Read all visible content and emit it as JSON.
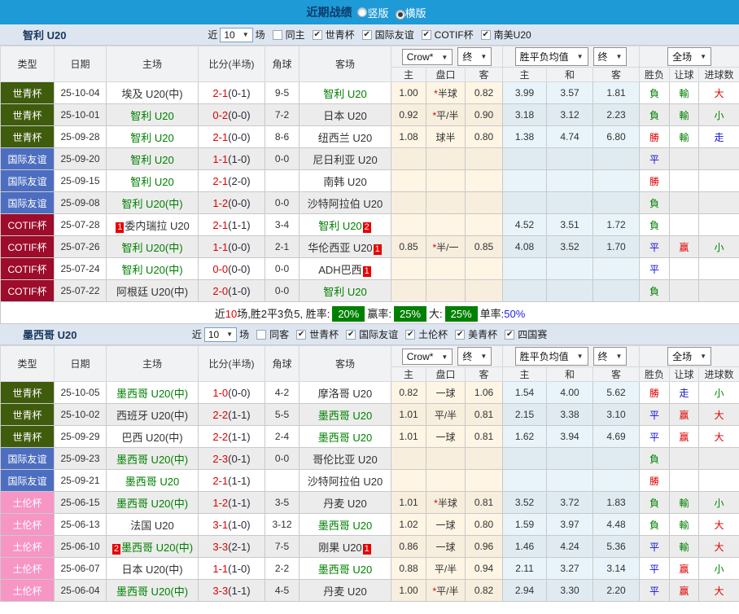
{
  "colors": {
    "topbar_blue": "#1e9ad6",
    "topbar_title": "#0b3b6a",
    "focus_team_green": "#008000",
    "score_red": "#e00000",
    "red_card_badge": "#e60000",
    "comp_world_youth": "#3f5b0c",
    "comp_friendly": "#4d6ec0",
    "comp_cotif": "#9d0c2a",
    "comp_toulon": "#f795c5",
    "summary_badge_green": "#008000"
  },
  "top_bar": {
    "title": "近期战绩",
    "radios": [
      {
        "label": "竖版",
        "selected": false
      },
      {
        "label": "横版",
        "selected": true
      }
    ]
  },
  "table_header": {
    "cols": [
      "类型",
      "日期",
      "主场",
      "比分(半场)",
      "角球",
      "客场"
    ],
    "odds_company_select": "Crow*",
    "odds_stage_select": "终",
    "avg_select": "胜平负均值",
    "avg_stage_select": "终",
    "scope_select": "全场",
    "sub_cols": [
      "主",
      "盘口",
      "客",
      "主",
      "和",
      "客",
      "胜负",
      "让球",
      "进球数"
    ]
  },
  "sections": [
    {
      "id": "chile-u20",
      "title": "智利 U20",
      "filter": {
        "near_label": "近",
        "count_value": "10",
        "games_label": "场",
        "same_venue": {
          "label": "同主",
          "checked": false
        },
        "comps": [
          {
            "label": "世青杯",
            "checked": true
          },
          {
            "label": "国际友谊",
            "checked": true
          },
          {
            "label": "COTIF杯",
            "checked": true
          },
          {
            "label": "南美U20",
            "checked": true
          }
        ]
      },
      "rows": [
        {
          "comp": "世青杯",
          "type": "wc",
          "date": "25-10-04",
          "home": {
            "n": "埃及 U20(中)",
            "f": false
          },
          "ft": "2-1",
          "ht": "(0-1)",
          "cr": "9-5",
          "away": {
            "n": "智利 U20",
            "f": true
          },
          "odds": [
            "1.00",
            "*半球",
            "0.82"
          ],
          "avg": [
            "3.99",
            "3.57",
            "1.81"
          ],
          "res": [
            [
              "負",
              "g"
            ],
            [
              "輸",
              "g"
            ],
            [
              "大",
              "r"
            ]
          ]
        },
        {
          "comp": "世青杯",
          "type": "wc",
          "date": "25-10-01",
          "home": {
            "n": "智利 U20",
            "f": true
          },
          "ft": "0-2",
          "ht": "(0-0)",
          "cr": "7-2",
          "away": {
            "n": "日本 U20",
            "f": false
          },
          "odds": [
            "0.92",
            "*平/半",
            "0.90"
          ],
          "avg": [
            "3.18",
            "3.12",
            "2.23"
          ],
          "res": [
            [
              "負",
              "g"
            ],
            [
              "輸",
              "g"
            ],
            [
              "小",
              "g"
            ]
          ]
        },
        {
          "comp": "世青杯",
          "type": "wc",
          "date": "25-09-28",
          "home": {
            "n": "智利 U20",
            "f": true
          },
          "ft": "2-1",
          "ht": "(0-0)",
          "cr": "8-6",
          "away": {
            "n": "纽西兰 U20",
            "f": false
          },
          "odds": [
            "1.08",
            "球半",
            "0.80"
          ],
          "avg": [
            "1.38",
            "4.74",
            "6.80"
          ],
          "res": [
            [
              "勝",
              "r"
            ],
            [
              "輸",
              "g"
            ],
            [
              "走",
              "b"
            ]
          ]
        },
        {
          "comp": "国际友谊",
          "type": "fr",
          "date": "25-09-20",
          "home": {
            "n": "智利 U20",
            "f": true
          },
          "ft": "1-1",
          "ht": "(1-0)",
          "cr": "0-0",
          "away": {
            "n": "尼日利亚 U20",
            "f": false
          },
          "odds": [
            "",
            "",
            ""
          ],
          "avg": [
            "",
            "",
            ""
          ],
          "res": [
            [
              "平",
              "b"
            ],
            [
              "",
              ""
            ],
            [
              "",
              ""
            ]
          ]
        },
        {
          "comp": "国际友谊",
          "type": "fr",
          "date": "25-09-15",
          "home": {
            "n": "智利 U20",
            "f": true
          },
          "ft": "2-1",
          "ht": "(2-0)",
          "cr": "",
          "away": {
            "n": "南韩 U20",
            "f": false
          },
          "odds": [
            "",
            "",
            ""
          ],
          "avg": [
            "",
            "",
            ""
          ],
          "res": [
            [
              "勝",
              "r"
            ],
            [
              "",
              ""
            ],
            [
              "",
              ""
            ]
          ]
        },
        {
          "comp": "国际友谊",
          "type": "fr",
          "date": "25-09-08",
          "home": {
            "n": "智利 U20(中)",
            "f": true
          },
          "ft": "1-2",
          "ht": "(0-0)",
          "cr": "0-0",
          "away": {
            "n": "沙特阿拉伯 U20",
            "f": false
          },
          "odds": [
            "",
            "",
            ""
          ],
          "avg": [
            "",
            "",
            ""
          ],
          "res": [
            [
              "負",
              "g"
            ],
            [
              "",
              ""
            ],
            [
              "",
              ""
            ]
          ]
        },
        {
          "comp": "COTIF杯",
          "type": "cotif",
          "date": "25-07-28",
          "home": {
            "n": "委内瑞拉 U20",
            "f": false,
            "bb": "1"
          },
          "ft": "2-1",
          "ht": "(1-1)",
          "cr": "3-4",
          "away": {
            "n": "智利 U20",
            "f": true,
            "ba": "2"
          },
          "odds": [
            "",
            "",
            ""
          ],
          "avg": [
            "4.52",
            "3.51",
            "1.72"
          ],
          "res": [
            [
              "負",
              "g"
            ],
            [
              "",
              ""
            ],
            [
              "",
              ""
            ]
          ]
        },
        {
          "comp": "COTIF杯",
          "type": "cotif",
          "date": "25-07-26",
          "home": {
            "n": "智利 U20(中)",
            "f": true
          },
          "ft": "1-1",
          "ht": "(0-0)",
          "cr": "2-1",
          "away": {
            "n": "华伦西亚 U20",
            "f": false,
            "ba": "1"
          },
          "odds": [
            "0.85",
            "*半/一",
            "0.85"
          ],
          "avg": [
            "4.08",
            "3.52",
            "1.70"
          ],
          "res": [
            [
              "平",
              "b"
            ],
            [
              "赢",
              "r"
            ],
            [
              "小",
              "g"
            ]
          ]
        },
        {
          "comp": "COTIF杯",
          "type": "cotif",
          "date": "25-07-24",
          "home": {
            "n": "智利 U20(中)",
            "f": true
          },
          "ft": "0-0",
          "ht": "(0-0)",
          "cr": "0-0",
          "away": {
            "n": "ADH巴西",
            "f": false,
            "ba": "1"
          },
          "odds": [
            "",
            "",
            ""
          ],
          "avg": [
            "",
            "",
            ""
          ],
          "res": [
            [
              "平",
              "b"
            ],
            [
              "",
              ""
            ],
            [
              "",
              ""
            ]
          ]
        },
        {
          "comp": "COTIF杯",
          "type": "cotif",
          "date": "25-07-22",
          "home": {
            "n": "阿根廷 U20(中)",
            "f": false
          },
          "ft": "2-0",
          "ht": "(1-0)",
          "cr": "0-0",
          "away": {
            "n": "智利 U20",
            "f": true
          },
          "odds": [
            "",
            "",
            ""
          ],
          "avg": [
            "",
            "",
            ""
          ],
          "res": [
            [
              "負",
              "g"
            ],
            [
              "",
              ""
            ],
            [
              "",
              ""
            ]
          ]
        }
      ],
      "summary_segments": [
        [
          "近",
          "k"
        ],
        [
          "10",
          "r"
        ],
        [
          "场,胜2平3负5, 胜率:",
          "k"
        ],
        [
          "20%",
          "badge"
        ],
        [
          "赢率:",
          "k"
        ],
        [
          "25%",
          "badge"
        ],
        [
          "大:",
          "k"
        ],
        [
          "25%",
          "badge"
        ],
        [
          "单率:",
          "k"
        ],
        [
          "50%",
          "b"
        ]
      ]
    },
    {
      "id": "mexico-u20",
      "title": "墨西哥 U20",
      "filter": {
        "near_label": "近",
        "count_value": "10",
        "games_label": "场",
        "same_venue": {
          "label": "同客",
          "checked": false
        },
        "comps": [
          {
            "label": "世青杯",
            "checked": true
          },
          {
            "label": "国际友谊",
            "checked": true
          },
          {
            "label": "土伦杯",
            "checked": true
          },
          {
            "label": "美青杯",
            "checked": true
          },
          {
            "label": "四国赛",
            "checked": true
          }
        ]
      },
      "rows": [
        {
          "comp": "世青杯",
          "type": "wc",
          "date": "25-10-05",
          "home": {
            "n": "墨西哥 U20(中)",
            "f": true
          },
          "ft": "1-0",
          "ht": "(0-0)",
          "cr": "4-2",
          "away": {
            "n": "摩洛哥 U20",
            "f": false
          },
          "odds": [
            "0.82",
            "一球",
            "1.06"
          ],
          "avg": [
            "1.54",
            "4.00",
            "5.62"
          ],
          "res": [
            [
              "勝",
              "r"
            ],
            [
              "走",
              "b"
            ],
            [
              "小",
              "g"
            ]
          ]
        },
        {
          "comp": "世青杯",
          "type": "wc",
          "date": "25-10-02",
          "home": {
            "n": "西班牙 U20(中)",
            "f": false
          },
          "ft": "2-2",
          "ht": "(1-1)",
          "cr": "5-5",
          "away": {
            "n": "墨西哥 U20",
            "f": true
          },
          "odds": [
            "1.01",
            "平/半",
            "0.81"
          ],
          "avg": [
            "2.15",
            "3.38",
            "3.10"
          ],
          "res": [
            [
              "平",
              "b"
            ],
            [
              "赢",
              "r"
            ],
            [
              "大",
              "r"
            ]
          ]
        },
        {
          "comp": "世青杯",
          "type": "wc",
          "date": "25-09-29",
          "home": {
            "n": "巴西 U20(中)",
            "f": false
          },
          "ft": "2-2",
          "ht": "(1-1)",
          "cr": "2-4",
          "away": {
            "n": "墨西哥 U20",
            "f": true
          },
          "odds": [
            "1.01",
            "一球",
            "0.81"
          ],
          "avg": [
            "1.62",
            "3.94",
            "4.69"
          ],
          "res": [
            [
              "平",
              "b"
            ],
            [
              "赢",
              "r"
            ],
            [
              "大",
              "r"
            ]
          ]
        },
        {
          "comp": "国际友谊",
          "type": "fr",
          "date": "25-09-23",
          "home": {
            "n": "墨西哥 U20(中)",
            "f": true
          },
          "ft": "2-3",
          "ht": "(0-1)",
          "cr": "0-0",
          "away": {
            "n": "哥伦比亚 U20",
            "f": false
          },
          "odds": [
            "",
            "",
            ""
          ],
          "avg": [
            "",
            "",
            ""
          ],
          "res": [
            [
              "負",
              "g"
            ],
            [
              "",
              ""
            ],
            [
              "",
              ""
            ]
          ]
        },
        {
          "comp": "国际友谊",
          "type": "fr",
          "date": "25-09-21",
          "home": {
            "n": "墨西哥 U20",
            "f": true
          },
          "ft": "2-1",
          "ht": "(1-1)",
          "cr": "",
          "away": {
            "n": "沙特阿拉伯 U20",
            "f": false
          },
          "odds": [
            "",
            "",
            ""
          ],
          "avg": [
            "",
            "",
            ""
          ],
          "res": [
            [
              "勝",
              "r"
            ],
            [
              "",
              ""
            ],
            [
              "",
              ""
            ]
          ]
        },
        {
          "comp": "土伦杯",
          "type": "toulon",
          "date": "25-06-15",
          "home": {
            "n": "墨西哥 U20(中)",
            "f": true
          },
          "ft": "1-2",
          "ht": "(1-1)",
          "cr": "3-5",
          "away": {
            "n": "丹麦 U20",
            "f": false
          },
          "odds": [
            "1.01",
            "*半球",
            "0.81"
          ],
          "avg": [
            "3.52",
            "3.72",
            "1.83"
          ],
          "res": [
            [
              "負",
              "g"
            ],
            [
              "輸",
              "g"
            ],
            [
              "小",
              "g"
            ]
          ]
        },
        {
          "comp": "土伦杯",
          "type": "toulon",
          "date": "25-06-13",
          "home": {
            "n": "法国 U20",
            "f": false
          },
          "ft": "3-1",
          "ht": "(1-0)",
          "cr": "3-12",
          "away": {
            "n": "墨西哥 U20",
            "f": true
          },
          "odds": [
            "1.02",
            "一球",
            "0.80"
          ],
          "avg": [
            "1.59",
            "3.97",
            "4.48"
          ],
          "res": [
            [
              "負",
              "g"
            ],
            [
              "輸",
              "g"
            ],
            [
              "大",
              "r"
            ]
          ]
        },
        {
          "comp": "土伦杯",
          "type": "toulon",
          "date": "25-06-10",
          "home": {
            "n": "墨西哥 U20(中)",
            "f": true,
            "bb": "2"
          },
          "ft": "3-3",
          "ht": "(2-1)",
          "cr": "7-5",
          "away": {
            "n": "刚果 U20",
            "f": false,
            "ba": "1"
          },
          "odds": [
            "0.86",
            "一球",
            "0.96"
          ],
          "avg": [
            "1.46",
            "4.24",
            "5.36"
          ],
          "res": [
            [
              "平",
              "b"
            ],
            [
              "輸",
              "g"
            ],
            [
              "大",
              "r"
            ]
          ]
        },
        {
          "comp": "土伦杯",
          "type": "toulon",
          "date": "25-06-07",
          "home": {
            "n": "日本 U20(中)",
            "f": false
          },
          "ft": "1-1",
          "ht": "(1-0)",
          "cr": "2-2",
          "away": {
            "n": "墨西哥 U20",
            "f": true
          },
          "odds": [
            "0.88",
            "平/半",
            "0.94"
          ],
          "avg": [
            "2.11",
            "3.27",
            "3.14"
          ],
          "res": [
            [
              "平",
              "b"
            ],
            [
              "赢",
              "r"
            ],
            [
              "小",
              "g"
            ]
          ]
        },
        {
          "comp": "土伦杯",
          "type": "toulon",
          "date": "25-06-04",
          "home": {
            "n": "墨西哥 U20(中)",
            "f": true
          },
          "ft": "3-3",
          "ht": "(1-1)",
          "cr": "4-5",
          "away": {
            "n": "丹麦 U20",
            "f": false
          },
          "odds": [
            "1.00",
            "*平/半",
            "0.82"
          ],
          "avg": [
            "2.94",
            "3.30",
            "2.20"
          ],
          "res": [
            [
              "平",
              "b"
            ],
            [
              "赢",
              "r"
            ],
            [
              "大",
              "r"
            ]
          ]
        }
      ],
      "summary_segments": null
    }
  ]
}
